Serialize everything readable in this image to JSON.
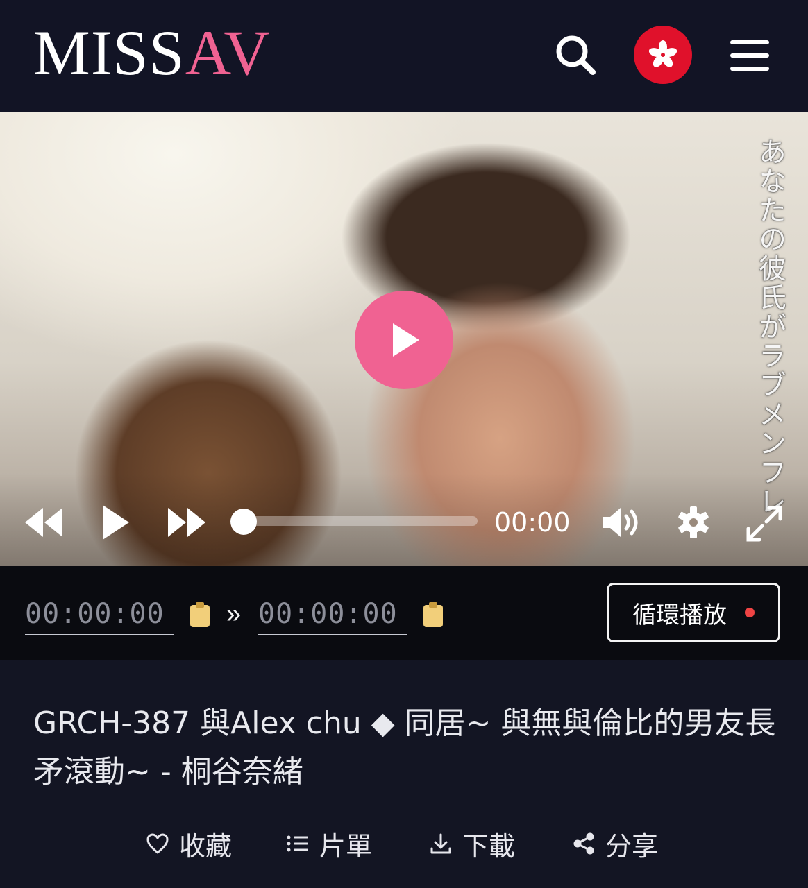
{
  "header": {
    "logo_part1": "MISS",
    "logo_part2": "AV",
    "search_icon": "search-icon",
    "language_flag": "hong-kong-flag",
    "menu_icon": "hamburger-menu-icon"
  },
  "video": {
    "overlay_text": "あなたの彼氏がラブメンフレ",
    "current_time": "00:00",
    "progress": 0,
    "controls": [
      "rewind-icon",
      "play-icon",
      "fast-forward-icon",
      "volume-icon",
      "settings-icon",
      "fullscreen-icon"
    ]
  },
  "loop": {
    "start_time": "00:00:00",
    "end_time": "00:00:00",
    "separator": "»",
    "button_label": "循環播放"
  },
  "title": "GRCH-387 與Alex chu ◆ 同居~ 與無與倫比的男友長矛滾動~ - 桐谷奈緒",
  "actions": {
    "favorite": "收藏",
    "playlist": "片單",
    "download": "下載",
    "share": "分享"
  },
  "colors": {
    "brand_pink": "#f06292",
    "background": "#131523",
    "loop_dot": "#ef4444",
    "clipboard": "#f2cf7a"
  }
}
